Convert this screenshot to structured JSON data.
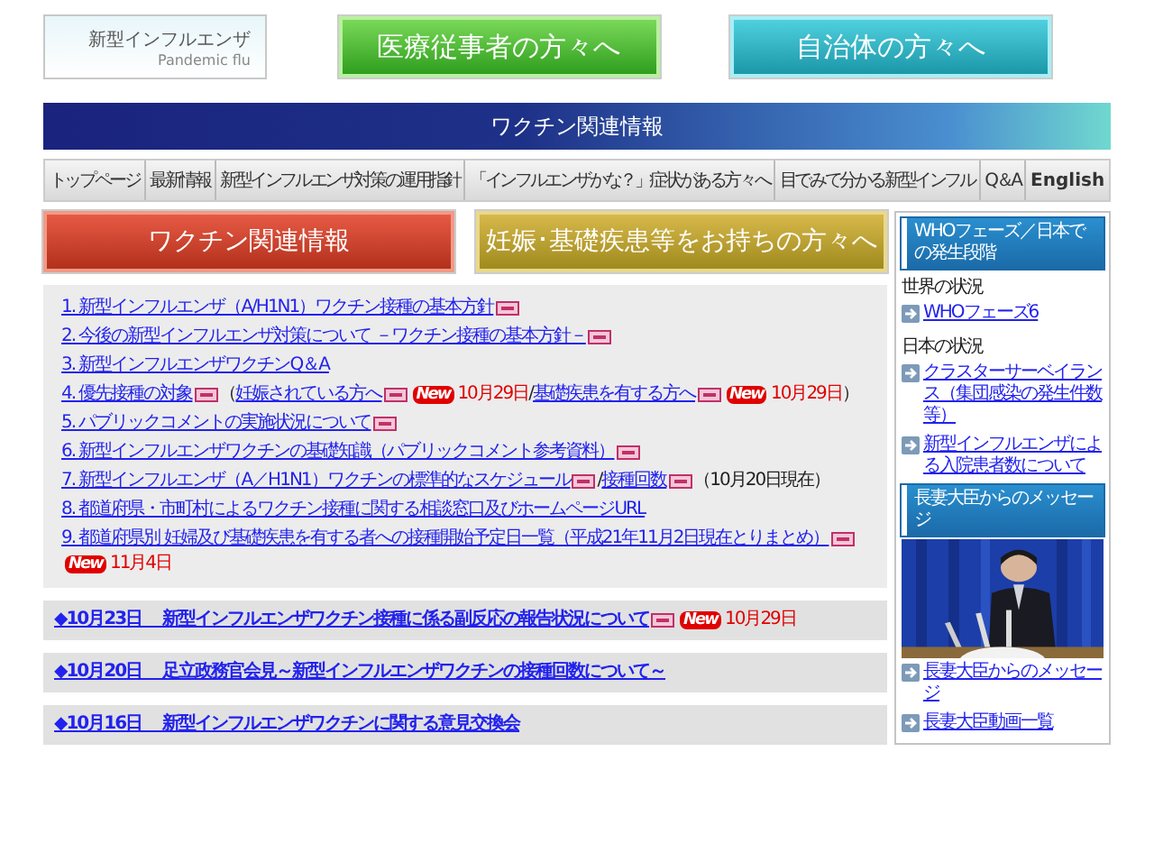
{
  "logo": {
    "title": "新型インフルエンザ",
    "subtitle": "Pandemic flu"
  },
  "top_buttons": [
    {
      "label": "医療従事者の方々へ",
      "kind": "green"
    },
    {
      "label": "自治体の方々へ",
      "kind": "teal"
    }
  ],
  "banner": {
    "title": "ワクチン関連情報"
  },
  "nav": [
    {
      "label": "トップページ"
    },
    {
      "label": "最新情報"
    },
    {
      "label": "新型インフルエンザ対策の運用指針"
    },
    {
      "label": "「インフルエンザかな？」症状がある方々へ"
    },
    {
      "label": "目でみて分かる新型インフル"
    },
    {
      "label": "Q＆A"
    },
    {
      "label": "English",
      "bold": true
    }
  ],
  "section_buttons": [
    {
      "label": "ワクチン関連情報",
      "kind": "red"
    },
    {
      "label": "妊娠･基礎疾患等をお持ちの方々へ",
      "kind": "mustard"
    }
  ],
  "documents": [
    [
      {
        "kind": "link",
        "text": "1. 新型インフルエンザ（A/H1N1）ワクチン接種の基本方針"
      },
      {
        "kind": "pdf"
      }
    ],
    [
      {
        "kind": "link",
        "text": "2. 今後の新型インフルエンザ対策について －ワクチン接種の基本方針－"
      },
      {
        "kind": "pdf"
      }
    ],
    [
      {
        "kind": "link",
        "text": "3. 新型インフルエンザワクチンQ＆A"
      }
    ],
    [
      {
        "kind": "link",
        "text": "4. 優先接種の対象"
      },
      {
        "kind": "pdf"
      },
      {
        "kind": "plain",
        "text": "（"
      },
      {
        "kind": "link",
        "text": "妊娠されている方へ"
      },
      {
        "kind": "pdf"
      },
      {
        "kind": "new",
        "text": "New"
      },
      {
        "kind": "date",
        "text": "10月29日"
      },
      {
        "kind": "plain",
        "text": " / "
      },
      {
        "kind": "link",
        "text": "基礎疾患を有する方へ"
      },
      {
        "kind": "pdf"
      },
      {
        "kind": "new",
        "text": "New"
      },
      {
        "kind": "date",
        "text": "10月29日"
      },
      {
        "kind": "plain",
        "text": "）"
      }
    ],
    [
      {
        "kind": "link",
        "text": "5. パブリックコメントの実施状況について"
      },
      {
        "kind": "pdf"
      }
    ],
    [
      {
        "kind": "link",
        "text": "6. 新型インフルエンザワクチンの基礎知識（パブリックコメント参考資料）"
      },
      {
        "kind": "pdf"
      }
    ],
    [
      {
        "kind": "link",
        "text": "7. 新型インフルエンザ（A／H1N1）ワクチンの標準的なスケジュール"
      },
      {
        "kind": "pdf"
      },
      {
        "kind": "plain",
        "text": "/"
      },
      {
        "kind": "link",
        "text": "接種回数"
      },
      {
        "kind": "pdf"
      },
      {
        "kind": "plain",
        "text": "（10月20日現在）"
      }
    ],
    [
      {
        "kind": "link",
        "text": "8. 都道府県・市町村によるワクチン接種に関する相談窓口及びホームページURL"
      }
    ],
    [
      {
        "kind": "link",
        "text": "9. 都道府県別 妊婦及び基礎疾患を有する者への接種開始予定日一覧（平成21年11月2日現在とりまとめ）"
      },
      {
        "kind": "pdf"
      },
      {
        "kind": "new",
        "text": "New"
      },
      {
        "kind": "date",
        "text": "11月4日"
      }
    ]
  ],
  "news": [
    [
      {
        "kind": "link",
        "text": "◆10月23日　 新型インフルエンザワクチン接種に係る副反応の報告状況について"
      },
      {
        "kind": "pdf"
      },
      {
        "kind": "new",
        "text": "New"
      },
      {
        "kind": "date",
        "text": "10月29日"
      }
    ],
    [
      {
        "kind": "link",
        "text": "◆10月20日　 足立政務官会見～新型インフルエンザワクチンの接種回数について～"
      }
    ],
    [
      {
        "kind": "link",
        "text": "◆10月16日　 新型インフルエンザワクチンに関する意見交換会"
      }
    ]
  ],
  "sidebar": {
    "who_header": "WHOフェーズ／日本での発生段階",
    "sections": [
      {
        "heading": "世界の状況",
        "links": [
          "WHOフェーズ6"
        ]
      },
      {
        "heading": "日本の状況",
        "links": [
          "クラスターサーベイランス（集団感染の発生件数等）",
          "新型インフルエンザによる入院患者数について"
        ]
      }
    ],
    "message_header": "長妻大臣からのメッセージ",
    "message_links": [
      "長妻大臣からのメッセージ",
      "長妻大臣動画一覧"
    ]
  }
}
